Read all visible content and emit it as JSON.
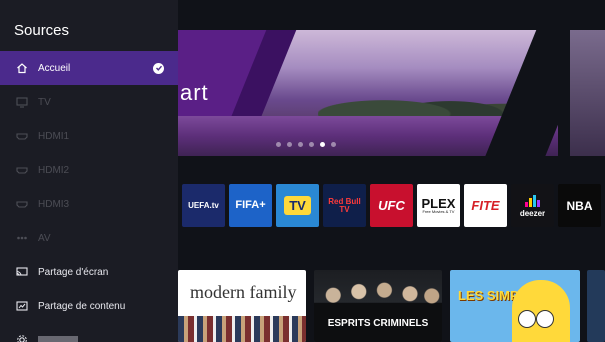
{
  "sidebar": {
    "title": "Sources",
    "items": [
      {
        "label": "Accueil",
        "icon": "home-icon",
        "state": "selected"
      },
      {
        "label": "TV",
        "icon": "tv-icon",
        "state": "dim"
      },
      {
        "label": "HDMI1",
        "icon": "hdmi-icon",
        "state": "dim"
      },
      {
        "label": "HDMI2",
        "icon": "hdmi-icon",
        "state": "dim"
      },
      {
        "label": "HDMI3",
        "icon": "hdmi-icon",
        "state": "dim"
      },
      {
        "label": "AV",
        "icon": "av-icon",
        "state": "dim"
      },
      {
        "label": "Partage d'écran",
        "icon": "screen-share-icon",
        "state": "normal"
      },
      {
        "label": "Partage de contenu",
        "icon": "content-share-icon",
        "state": "normal"
      }
    ]
  },
  "hero": {
    "text": "art",
    "slides": 6,
    "active_slide": 5
  },
  "apps": [
    {
      "name": "UEFA.tv",
      "bg": "#1b2a6b"
    },
    {
      "name": "FIFA+",
      "bg": "#1d63c8"
    },
    {
      "name": "TV",
      "bg": "#2a88d4"
    },
    {
      "name": "Red Bull TV",
      "bg": "#0f1f4a"
    },
    {
      "name": "UFC",
      "bg": "#c8102e"
    },
    {
      "name": "PLEX",
      "sub": "Free Movies & TV",
      "bg": "#ffffff"
    },
    {
      "name": "FITE",
      "bg": "#ffffff"
    },
    {
      "name": "deezer",
      "bg": "#121216"
    },
    {
      "name": "NBA",
      "bg": "#0a0a0a"
    }
  ],
  "cards": [
    {
      "title": "modern family"
    },
    {
      "title": "ESPRITS CRIMINELS"
    },
    {
      "title": "LES SIMPSON"
    }
  ],
  "colors": {
    "accent": "#4b2a8c",
    "background": "#101218"
  }
}
